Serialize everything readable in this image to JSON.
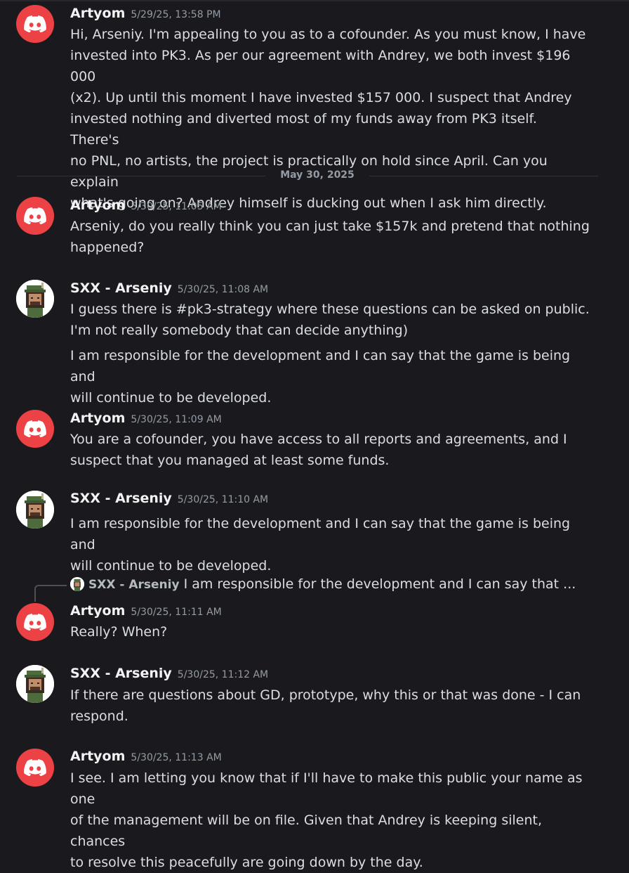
{
  "date_divider": "May 30, 2025",
  "messages": [
    {
      "author": "Artyom",
      "timestamp": "5/29/25, 13:58 PM",
      "lines": [
        "Hi, Arseniy. I'm appealing to you as to a cofounder. As you must know, I have",
        "invested into PK3. As per our agreement with Andrey, we both invest $196 000",
        "(x2). Up until this moment I have invested $157 000. I suspect that Andrey",
        "invested nothing and diverted most of my funds away from PK3 itself. There's",
        "no PNL, no artists, the project is practically on hold since April. Can you explain",
        "what's going on? Andrey himself is ducking out when I ask him directly."
      ]
    },
    {
      "author": "Artyom",
      "timestamp": "5/30/25, 11:05 AM",
      "lines": [
        "Arseniy, do you really think you can just take $157k and pretend that nothing",
        "happened?"
      ]
    },
    {
      "author": "SXX - Arseniy",
      "timestamp": "5/30/25, 11:08 AM",
      "lines": [
        "I guess there is #pk3-strategy where these questions can be asked on public.",
        "I'm not really somebody that can decide anything)"
      ],
      "lines2": [
        "I am responsible for the development and I can say that the game is being and",
        "will continue to be developed."
      ]
    },
    {
      "author": "Artyom",
      "timestamp": "5/30/25, 11:09 AM",
      "lines": [
        "You are a cofounder, you have access to all reports and agreements, and I",
        "suspect that you managed at least some funds."
      ]
    },
    {
      "author": "SXX - Arseniy",
      "timestamp": "5/30/25, 11:10 AM",
      "lines": [
        "I am responsible for the development and I can say that the game is being and",
        "will continue to be developed."
      ]
    },
    {
      "author": "Artyom",
      "timestamp": "5/30/25, 11:11 AM",
      "reply": {
        "author": "SXX - Arseniy",
        "text": "I am responsible for the development and I can say that ..."
      },
      "lines": [
        "Really? When?"
      ]
    },
    {
      "author": "SXX - Arseniy",
      "timestamp": "5/30/25, 11:12 AM",
      "lines": [
        "If there are questions about GD, prototype, why this or that was done - I can",
        "respond."
      ]
    },
    {
      "author": "Artyom",
      "timestamp": "5/30/25, 11:13 AM",
      "lines": [
        "I see. I am letting you know that if I'll have to make this public your name as one",
        "of the management will be on file. Given that Andrey is keeping silent, chances",
        "to resolve this peacefully are going down by the day."
      ]
    }
  ]
}
